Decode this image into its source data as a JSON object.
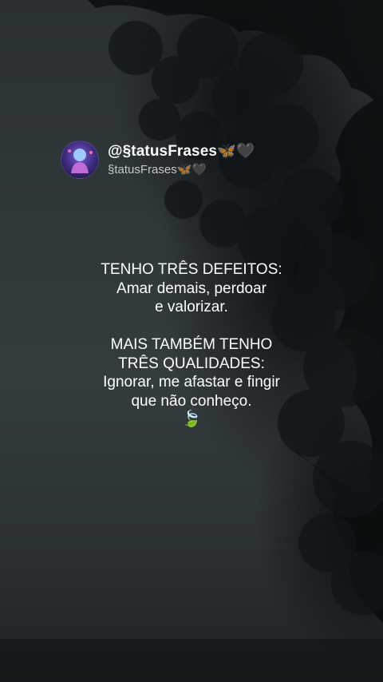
{
  "post": {
    "handle": "@§tatusFrases🦋🖤",
    "subname": "§tatusFrases🦋🖤",
    "avatar_icon": "avatar-icon"
  },
  "quote": {
    "lines_part1": [
      "TENHO TRÊS DEFEITOS:",
      "Amar demais, perdoar",
      "e valorizar."
    ],
    "lines_part2": [
      "MAIS TAMBÉM TENHO",
      "TRÊS QUALIDADES:",
      "Ignorar, me afastar e fingir",
      "que não conheço."
    ],
    "emoji": "🍃"
  },
  "colors": {
    "background": "#1c2124",
    "text": "#ffffff",
    "subtext": "#c4c8cb"
  }
}
